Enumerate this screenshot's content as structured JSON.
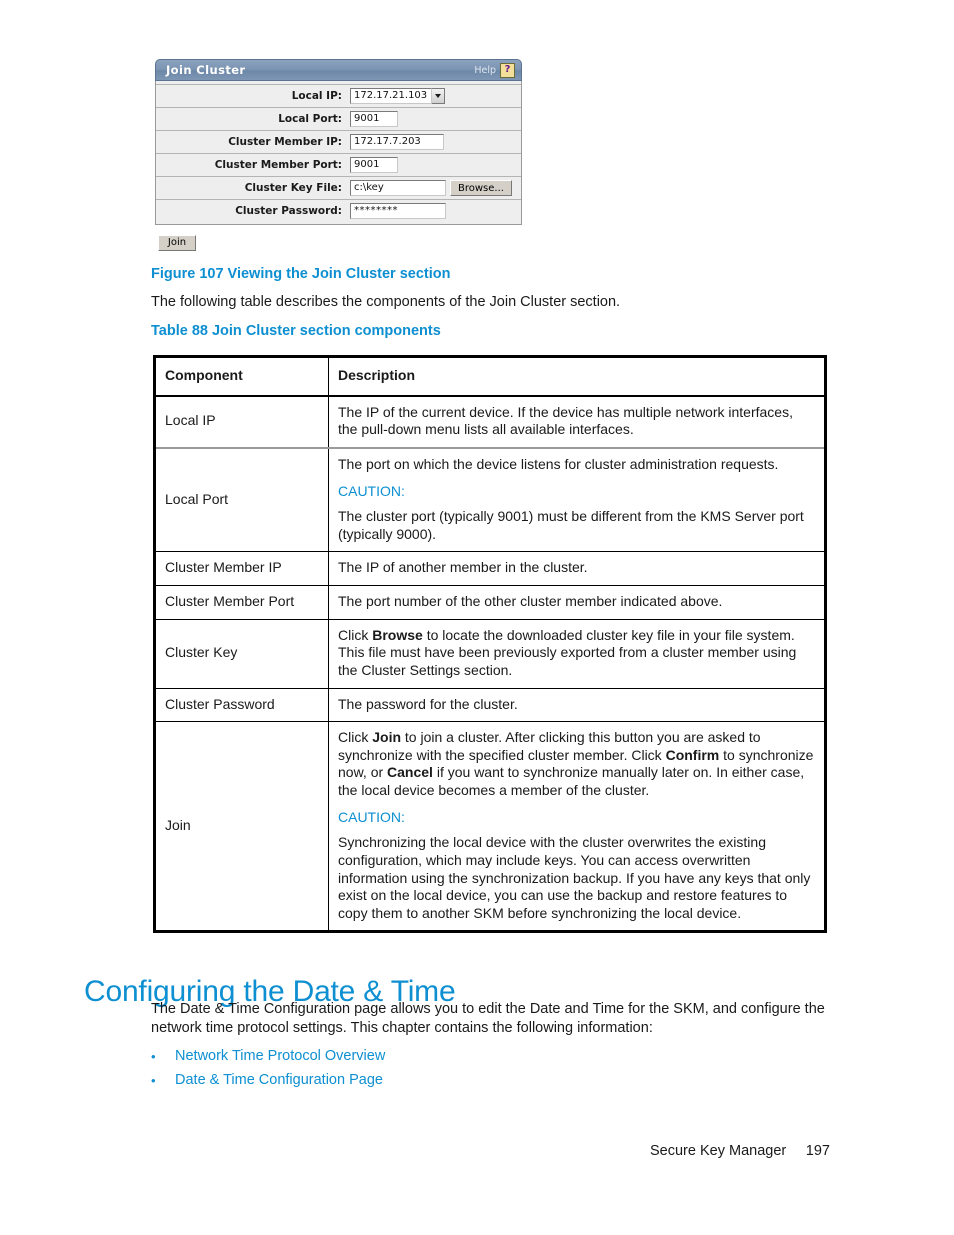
{
  "figure": {
    "panel_title": "Join Cluster",
    "help_label": "Help",
    "help_icon_glyph": "?",
    "fields": [
      {
        "label": "Local IP:",
        "value": "172.17.21.103",
        "type": "select"
      },
      {
        "label": "Local Port:",
        "value": "9001",
        "type": "text"
      },
      {
        "label": "Cluster Member IP:",
        "value": "172.17.7.203",
        "type": "text"
      },
      {
        "label": "Cluster Member Port:",
        "value": "9001",
        "type": "text"
      },
      {
        "label": "Cluster Key File:",
        "value": "c:\\key",
        "type": "file"
      },
      {
        "label": "Cluster Password:",
        "value": "********",
        "type": "password"
      }
    ],
    "browse_label": "Browse...",
    "join_label": "Join",
    "caption": "Figure 107 Viewing the Join Cluster section"
  },
  "intro_text": "The following table describes the components of the Join Cluster section.",
  "table": {
    "caption": "Table 88 Join Cluster section components",
    "headers": [
      "Component",
      "Description"
    ],
    "rows": [
      {
        "component": "Local IP",
        "paragraphs": [
          {
            "text": "The IP of the current device. If the device has multiple network interfaces, the pull-down menu lists all available interfaces."
          }
        ]
      },
      {
        "component": "Local Port",
        "paragraphs": [
          {
            "text": "The port on which the device listens for cluster administration requests."
          },
          {
            "caution": "CAUTION:"
          },
          {
            "text": "The cluster port (typically 9001) must be different from the KMS Server port (typically 9000)."
          }
        ]
      },
      {
        "component": "Cluster Member IP",
        "paragraphs": [
          {
            "text": "The IP of another member in the cluster."
          }
        ]
      },
      {
        "component": "Cluster Member Port",
        "paragraphs": [
          {
            "text": "The port number of the other cluster member indicated above."
          }
        ]
      },
      {
        "component": "Cluster Key",
        "paragraphs": [
          {
            "html": "Click <b>Browse</b> to locate the downloaded cluster key file in your file system. This file must have been previously exported from a cluster member using the Cluster Settings section."
          }
        ]
      },
      {
        "component": "Cluster Password",
        "paragraphs": [
          {
            "text": "The password for the cluster."
          }
        ]
      },
      {
        "component": "Join",
        "paragraphs": [
          {
            "html": "Click <b>Join</b> to join a cluster. After clicking this button you are asked to synchronize with the specified cluster member. Click <b>Confirm</b> to synchronize now, or <b>Cancel</b> if you want to synchronize manually later on. In either case, the local device becomes a member of the cluster."
          },
          {
            "caution": "CAUTION:"
          },
          {
            "text": "Synchronizing the local device with the cluster overwrites the existing configuration, which may include keys. You can access overwritten information using the synchronization backup. If you have any keys that only exist on the local device, you can use the backup and restore features to copy them to another SKM before synchronizing the local device."
          }
        ]
      }
    ]
  },
  "section": {
    "heading": "Configuring the Date & Time",
    "paragraph": "The Date & Time Configuration page allows you to edit the Date and Time for the SKM, and configure the network time protocol settings. This chapter contains the following information:",
    "bullet_glyph": "•",
    "links": [
      "Network Time Protocol Overview",
      "Date & Time Configuration Page"
    ]
  },
  "footer": {
    "book_title": "Secure Key Manager",
    "page_number": "197"
  },
  "colors": {
    "accent_blue": "#0d8fd1",
    "panel_header": "#6d87a8",
    "help_icon_bg": "#f2e09a",
    "help_icon_fg": "#6b1b8c",
    "table_border": "#000000",
    "text": "#1a1a1a"
  }
}
